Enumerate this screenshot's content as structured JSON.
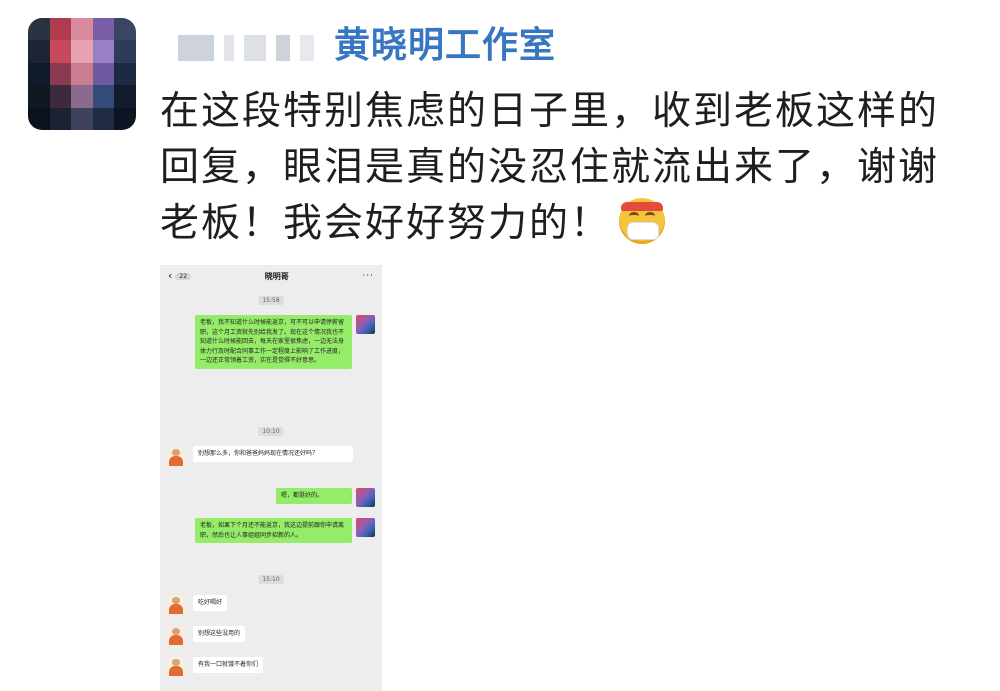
{
  "post": {
    "author": "黄晓明工作室",
    "text": "在这段特别焦虑的日子里，收到老板这样的回复，眼泪是真的没忍住就流出来了，谢谢老板！我会好好努力的！",
    "emoji_icon": "mask-face-emoji-icon"
  },
  "chat": {
    "back_count": "22",
    "title": "晓明哥",
    "more": "···",
    "timestamps": [
      "15:58",
      "10:10",
      "15:10"
    ],
    "messages": [
      {
        "sender": "me",
        "text": "老板，我不知道什么时候能返京，可不可以申请停薪留职，这个月工资就先别给我发了。现在这个情况我也不知道什么时候能回去，每天在家里很焦虑，一边无法身体力行及时配合同事工作一定程度上影响了工作进度，一边还正常领着工资，实在是觉得不好意思。"
      },
      {
        "sender": "boss",
        "text": "别想那么多，你和爸爸妈妈现在情况还好吗？"
      },
      {
        "sender": "me",
        "text": "嗯，都挺好的。"
      },
      {
        "sender": "me",
        "text": "老板，如果下个月还不能返京，我这边提前跟你申请离职，然后也让人事姐姐同步招新的人。"
      },
      {
        "sender": "boss",
        "text": "吃好喝好"
      },
      {
        "sender": "boss",
        "text": "别想这些没用的"
      },
      {
        "sender": "boss",
        "text": "有我一口就饿不着你们"
      }
    ]
  },
  "colors": {
    "author_blue": "#3777c1",
    "my_bubble": "#95ec69",
    "chat_bg": "#ededed"
  }
}
